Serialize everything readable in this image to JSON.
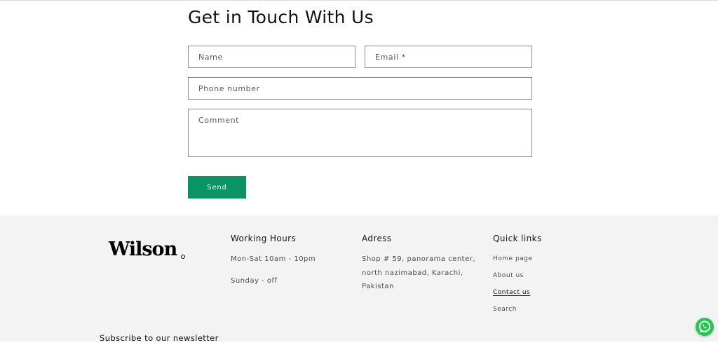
{
  "contact_form": {
    "heading": "Get in Touch With Us",
    "name_placeholder": "Name",
    "email_placeholder": "Email *",
    "phone_placeholder": "Phone number",
    "comment_placeholder": "Comment",
    "send_label": "Send"
  },
  "footer": {
    "brand": "Wilson",
    "working_hours": {
      "title": "Working Hours",
      "lines": [
        "Mon-Sat 10am - 10pm",
        "Sunday - off"
      ]
    },
    "address": {
      "title": "Adress",
      "text": "Shop # 59, panorama center, north nazimabad, Karachi, Pakistan"
    },
    "quick_links": {
      "title": "Quick links",
      "items": [
        "Home page",
        "About us",
        "Contact us",
        "Search"
      ]
    },
    "newsletter_title": "Subscribe to our newsletter"
  },
  "colors": {
    "send_button": "#0a9466",
    "footer_background": "#f3f3f3",
    "whatsapp": "#29c553"
  },
  "icons": {
    "chat": "whatsapp-icon"
  }
}
